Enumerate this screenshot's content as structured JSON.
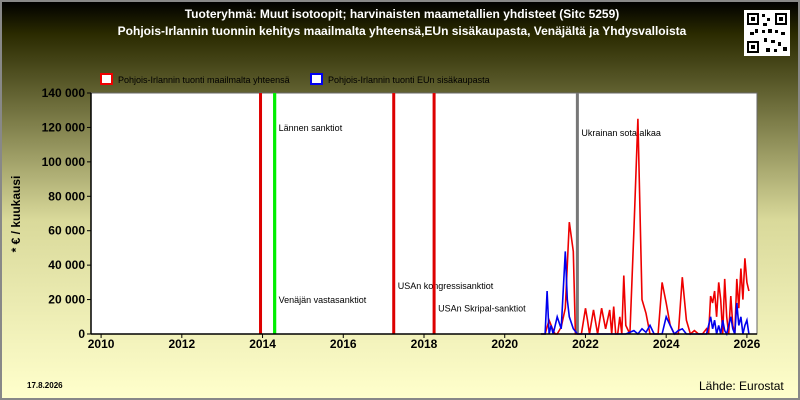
{
  "header": {
    "title_line1": "Tuoteryhmä: Muut isotoopit; harvinaisten maametallien yhdisteet (Sitc 5259)",
    "title_line2": "Pohjois-Irlannin tuonnin kehitys maailmalta yhteensä,EUn sisäkaupasta, Venäjältä ja Yhdysvalloista"
  },
  "footer": {
    "date": "17.8.2026",
    "source": "Lähde: Eurostat"
  },
  "chart_data": {
    "type": "line",
    "ylabel": "* € / kuukausi",
    "xlim": [
      2009.75,
      2026.25
    ],
    "ylim": [
      0,
      140000
    ],
    "yticks": [
      0,
      20000,
      40000,
      60000,
      80000,
      100000,
      120000,
      140000
    ],
    "ytick_labels": [
      "0",
      "20 000",
      "40 000",
      "60 000",
      "80 000",
      "100 000",
      "120 000",
      "140 000"
    ],
    "xticks": [
      2010,
      2012,
      2014,
      2016,
      2018,
      2020,
      2022,
      2024,
      2026
    ],
    "xtick_labels": [
      "2010",
      "2012",
      "2014",
      "2016",
      "2018",
      "2020",
      "2022",
      "2024",
      "2026"
    ],
    "grid": false,
    "legend_placement": "top-left",
    "events": [
      {
        "x": 2013.95,
        "color": "#dd0000",
        "label": "",
        "label_y": 0
      },
      {
        "x": 2014.3,
        "color": "#00ee00",
        "label": "Lännen sanktiot",
        "label_y": 118000
      },
      {
        "x": 2014.3,
        "color": "#00ee00",
        "label": "Venäjän vastasanktiot",
        "label_y": 18000
      },
      {
        "x": 2017.25,
        "color": "#dd0000",
        "label": "USAn kongressisanktiot",
        "label_y": 26000
      },
      {
        "x": 2018.25,
        "color": "#dd0000",
        "label": "USAn Skripal-sanktiot",
        "label_y": 13000
      },
      {
        "x": 2021.8,
        "color": "#777777",
        "label": "Ukrainan sota alkaa",
        "label_y": 115000
      }
    ],
    "series": [
      {
        "name": "Pohjois-Irlannin tuonti maailmalta yhteensä",
        "color": "#ee0000",
        "x": [
          2020.9,
          2021.0,
          2021.1,
          2021.2,
          2021.25,
          2021.3,
          2021.4,
          2021.5,
          2021.6,
          2021.7,
          2021.75,
          2021.8,
          2021.9,
          2022.0,
          2022.05,
          2022.1,
          2022.2,
          2022.3,
          2022.4,
          2022.5,
          2022.6,
          2022.65,
          2022.7,
          2022.75,
          2022.8,
          2022.85,
          2022.9,
          2022.95,
          2023.0,
          2023.1,
          2023.2,
          2023.3,
          2023.4,
          2023.5,
          2023.6,
          2023.7,
          2023.8,
          2023.9,
          2024.0,
          2024.1,
          2024.2,
          2024.3,
          2024.4,
          2024.5,
          2024.6,
          2024.7,
          2024.8,
          2024.9,
          2025.0,
          2025.05,
          2025.1,
          2025.15,
          2025.2,
          2025.25,
          2025.3,
          2025.35,
          2025.4,
          2025.45,
          2025.5,
          2025.55,
          2025.6,
          2025.65,
          2025.7,
          2025.75,
          2025.8,
          2025.85,
          2025.9,
          2025.95,
          2026.0,
          2026.05
        ],
        "values": [
          0,
          0,
          8000,
          2000,
          0,
          0,
          4000,
          15000,
          65000,
          48000,
          0,
          0,
          0,
          15000,
          8000,
          0,
          14000,
          0,
          15000,
          3000,
          14000,
          0,
          16000,
          0,
          0,
          10000,
          0,
          34000,
          5000,
          0,
          60000,
          125000,
          20000,
          12000,
          0,
          0,
          0,
          30000,
          18000,
          5000,
          0,
          0,
          33000,
          8000,
          0,
          2000,
          0,
          0,
          3000,
          0,
          22000,
          18000,
          25000,
          10000,
          30000,
          20000,
          0,
          32000,
          10000,
          0,
          22000,
          5000,
          0,
          32000,
          15000,
          38000,
          20000,
          44000,
          30000,
          25000
        ]
      },
      {
        "name": "Pohjois-Irlannin tuonti EUn sisäkaupasta",
        "color": "#0000ee",
        "x": [
          2020.9,
          2021.0,
          2021.05,
          2021.1,
          2021.15,
          2021.2,
          2021.3,
          2021.4,
          2021.5,
          2021.55,
          2021.6,
          2021.7,
          2021.8,
          2021.9,
          2022.0,
          2022.2,
          2022.4,
          2022.6,
          2022.8,
          2023.0,
          2023.2,
          2023.3,
          2023.4,
          2023.5,
          2023.6,
          2023.7,
          2023.8,
          2023.9,
          2024.0,
          2024.1,
          2024.2,
          2024.3,
          2024.4,
          2024.5,
          2024.6,
          2024.7,
          2024.8,
          2024.9,
          2025.0,
          2025.05,
          2025.1,
          2025.15,
          2025.2,
          2025.25,
          2025.3,
          2025.35,
          2025.4,
          2025.45,
          2025.5,
          2025.55,
          2025.6,
          2025.65,
          2025.7,
          2025.75,
          2025.8,
          2025.85,
          2025.9,
          2025.95,
          2026.0,
          2026.05
        ],
        "values": [
          0,
          0,
          25000,
          0,
          5000,
          0,
          10000,
          3000,
          48000,
          20000,
          10000,
          3000,
          0,
          0,
          0,
          0,
          0,
          0,
          0,
          0,
          2000,
          0,
          3000,
          1000,
          5000,
          0,
          0,
          0,
          10000,
          5000,
          0,
          2000,
          3000,
          0,
          0,
          0,
          0,
          0,
          0,
          5000,
          10000,
          3000,
          8000,
          0,
          5000,
          0,
          8000,
          2000,
          0,
          5000,
          10000,
          3000,
          0,
          18000,
          5000,
          10000,
          0,
          5000,
          8000,
          0
        ]
      }
    ]
  }
}
